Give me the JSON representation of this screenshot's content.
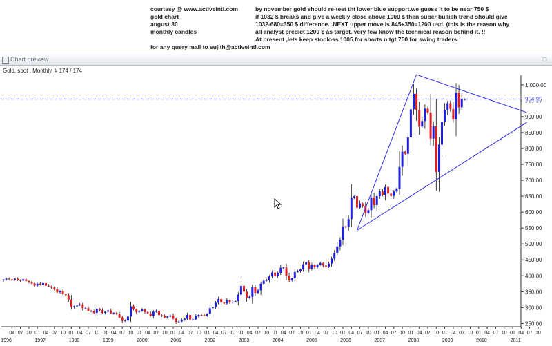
{
  "notes": {
    "left": [
      "courtesy @ www.activeintl.com",
      "gold chart",
      "august 30",
      "monthly candles"
    ],
    "right": [
      "by november gold should re-test tht  lower blue support.we guess it to be near 750 $",
      "if 1032 $ breaks and give a weekly close above 1000 $ then super bullish trend should give",
      "1032-680=350 $ difference. .NEXT upper move is 845+350=1200 usd. (this is the reason why",
      "  all analyst predict 1200 $ as target. very few know the technical reason behind it. !!",
      "At present ,lets keep stoploss 1005 for shorts n tgt 750 for swing traders."
    ],
    "footer": "for any query mail to sujith@activeintl.com"
  },
  "window": {
    "title": "Chart preview"
  },
  "chart_info": "Gold, spot , Monthly, # 174 / 174",
  "chart_data": {
    "type": "candlestick",
    "ylim": [
      240,
      1030
    ],
    "y_ticks": [
      250,
      300,
      350,
      400,
      450,
      500,
      550,
      600,
      650,
      700,
      750,
      800,
      850,
      900,
      950,
      1000
    ],
    "y_tick_labels": [
      "250.00",
      "300.00",
      "350.00",
      "400.00",
      "450.00",
      "500.00",
      "550.00",
      "600.00",
      "650.00",
      "700.00",
      "750.00",
      "800.00",
      "850.00",
      "900.00",
      "950.00",
      "1,000.00"
    ],
    "current_price": 954.95,
    "current_price_label": "954.95",
    "x_month_labels": [
      "04",
      "07",
      "10",
      "01",
      "04",
      "07",
      "10",
      "01",
      "04",
      "07",
      "10",
      "01",
      "04",
      "07",
      "10",
      "01",
      "04",
      "07",
      "10",
      "01",
      "04",
      "07",
      "10",
      "01",
      "04",
      "07",
      "10",
      "01",
      "04",
      "07",
      "10",
      "01",
      "04",
      "07",
      "10",
      "01",
      "04",
      "07",
      "10",
      "01",
      "04",
      "07",
      "10",
      "01",
      "04",
      "07",
      "10",
      "01",
      "04",
      "07",
      "10",
      "01",
      "04",
      "07",
      "10",
      "01",
      "04",
      "07",
      "10",
      "01",
      "04",
      "07",
      "10"
    ],
    "x_year_labels": [
      "1996",
      "1997",
      "1998",
      "1999",
      "2000",
      "2001",
      "2002",
      "2003",
      "2004",
      "2005",
      "2006",
      "2007",
      "2008",
      "2009",
      "2010",
      "2011"
    ],
    "start": "1996-01",
    "closes": [
      388,
      391,
      389,
      388,
      391,
      386,
      385,
      389,
      383,
      380,
      376,
      369,
      375,
      372,
      377,
      369,
      367,
      363,
      357,
      348,
      352,
      343,
      339,
      325,
      302,
      304,
      307,
      310,
      298,
      298,
      290,
      289,
      283,
      296,
      292,
      283,
      287,
      291,
      282,
      283,
      279,
      269,
      258,
      259,
      272,
      304,
      294,
      286,
      289,
      294,
      286,
      282,
      274,
      287,
      290,
      276,
      274,
      269,
      272,
      275,
      265,
      255,
      256,
      262,
      265,
      277,
      262,
      263,
      273,
      277,
      276,
      275,
      280,
      298,
      302,
      315,
      327,
      316,
      313,
      323,
      316,
      318,
      320,
      341,
      368,
      350,
      330,
      334,
      364,
      346,
      354,
      375,
      384,
      386,
      398,
      410,
      399,
      409,
      425,
      426,
      400,
      386,
      392,
      412,
      414,
      420,
      436,
      442,
      422,
      434,
      427,
      434,
      440,
      432,
      428,
      438,
      454,
      471,
      492,
      513,
      555,
      554,
      578,
      645,
      650,
      614,
      627,
      619,
      596,
      606,
      646,
      622,
      650,
      665,
      654,
      679,
      658,
      651,
      665,
      673,
      742,
      790,
      783,
      835,
      923,
      972,
      921,
      869,
      886,
      925,
      913,
      831,
      870,
      726,
      812,
      884,
      920,
      942,
      924,
      891,
      975,
      929,
      955,
      955
    ],
    "trendlines": [
      {
        "name": "upper",
        "from": [
          "2008-03",
          1032
        ],
        "to": [
          "2011-06",
          913
        ]
      },
      {
        "name": "lower",
        "from": [
          "2006-06",
          543
        ],
        "to": [
          "2011-06",
          882
        ]
      },
      {
        "name": "left",
        "from": [
          "2006-06",
          543
        ],
        "to": [
          "2008-03",
          1032
        ]
      }
    ],
    "colors": {
      "up": "#1f1fe0",
      "down": "#e01f1f",
      "axis": "#333333",
      "trendline": "#2a2ae8",
      "price_line": "#3b3bf0"
    }
  }
}
